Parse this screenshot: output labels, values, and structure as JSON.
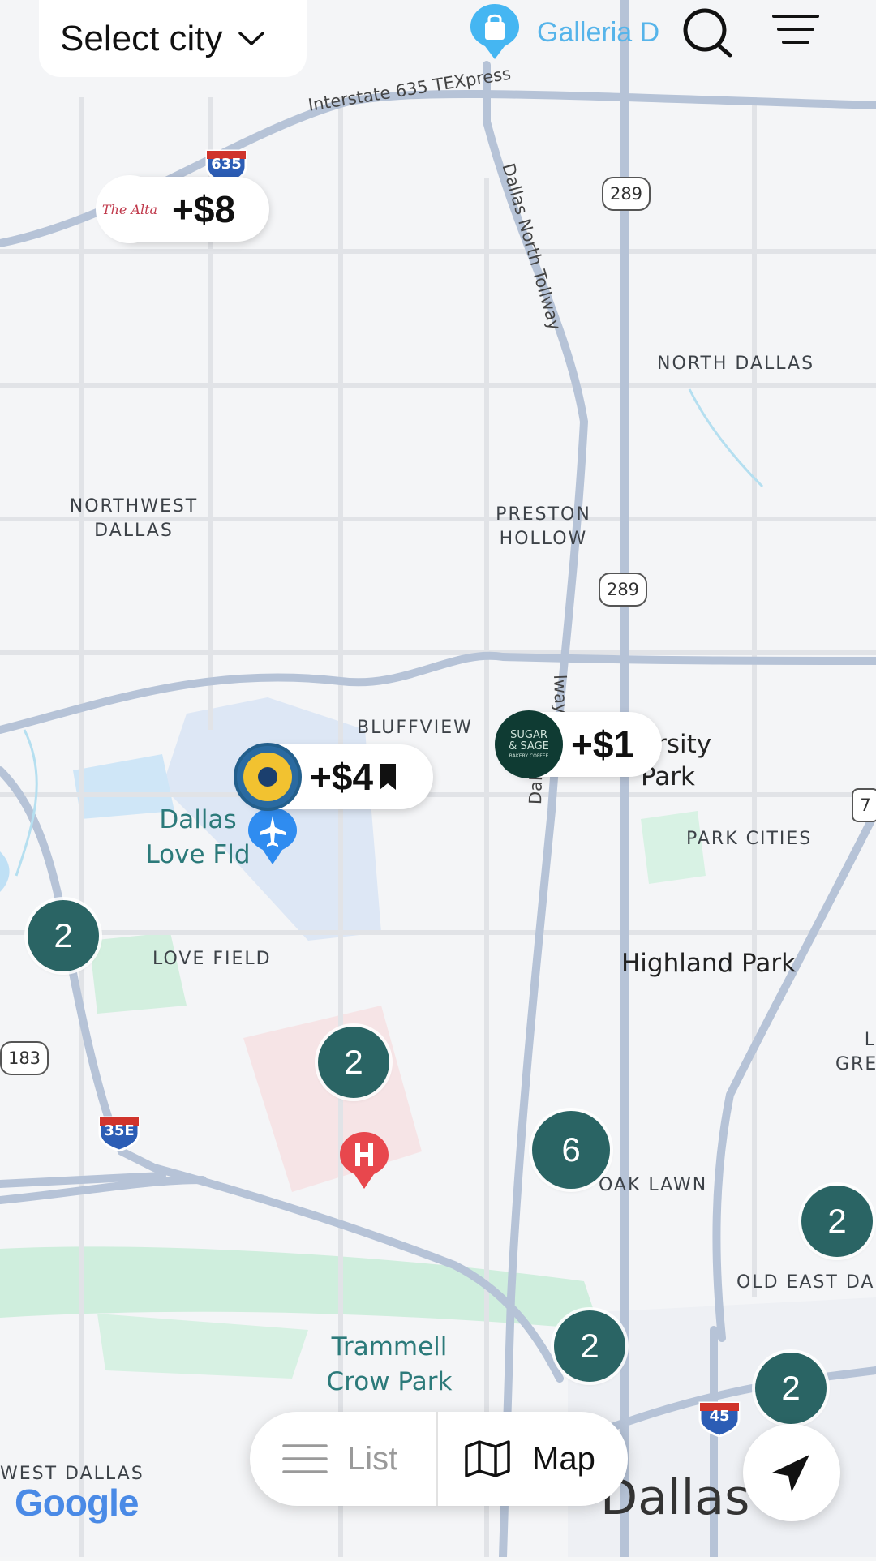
{
  "header": {
    "city_label": "Select city",
    "search_pin_label": "Galleria D"
  },
  "map_labels": {
    "north_dallas": "NORTH DALLAS",
    "northwest_dallas_line1": "NORTHWEST",
    "northwest_dallas_line2": "DALLAS",
    "preston_hollow_line1": "PRESTON",
    "preston_hollow_line2": "HOLLOW",
    "bluffview": "BLUFFVIEW",
    "university_park_line1": "ersity",
    "university_park_line2": "Park",
    "park_cities": "PARK CITIES",
    "highland_park": "Highland Park",
    "love_field": "LOVE FIELD",
    "dallas_love_fld_line1": "Dallas",
    "dallas_love_fld_line2": "Love Fld",
    "oak_lawn": "OAK LAWN",
    "old_east_dallas": "OLD EAST DA",
    "trammell_crow_line1": "Trammell",
    "trammell_crow_line2": "Crow Park",
    "west_dallas": "WEST DALLAS",
    "dallas": "Dallas",
    "edge_label_line1": "L",
    "edge_label_line2": "GRE",
    "interstate_635": "Interstate 635 TEXpress",
    "dallas_north_tollway": "Dallas North Tollway",
    "dallas_tollway_lower": "Dallas N",
    "dallas_tollway_mid": "lway",
    "google": "Google"
  },
  "shields": {
    "i635": "635",
    "r289_top": "289",
    "r289_mid": "289",
    "r183": "183",
    "i35e": "35E",
    "i45": "45",
    "edge_shield": "7"
  },
  "offers": [
    {
      "price": "+$8",
      "brand": "The Alta"
    },
    {
      "price": "+$4",
      "bookmarked": true
    },
    {
      "price": "+$1",
      "brand_line1": "SUGAR",
      "brand_line2": "& SAGE",
      "brand_line3": "BAKERY COFFEE"
    }
  ],
  "clusters": [
    "2",
    "2",
    "6",
    "2",
    "2",
    "2"
  ],
  "toolbar": {
    "list_label": "List",
    "map_label": "Map",
    "active": "Map"
  },
  "colors": {
    "cluster": "#2a6464",
    "road_major": "#a9b8d0",
    "poi_text": "#2c7a7a",
    "hospital": "#e8474d",
    "airport": "#2f8cf0"
  }
}
